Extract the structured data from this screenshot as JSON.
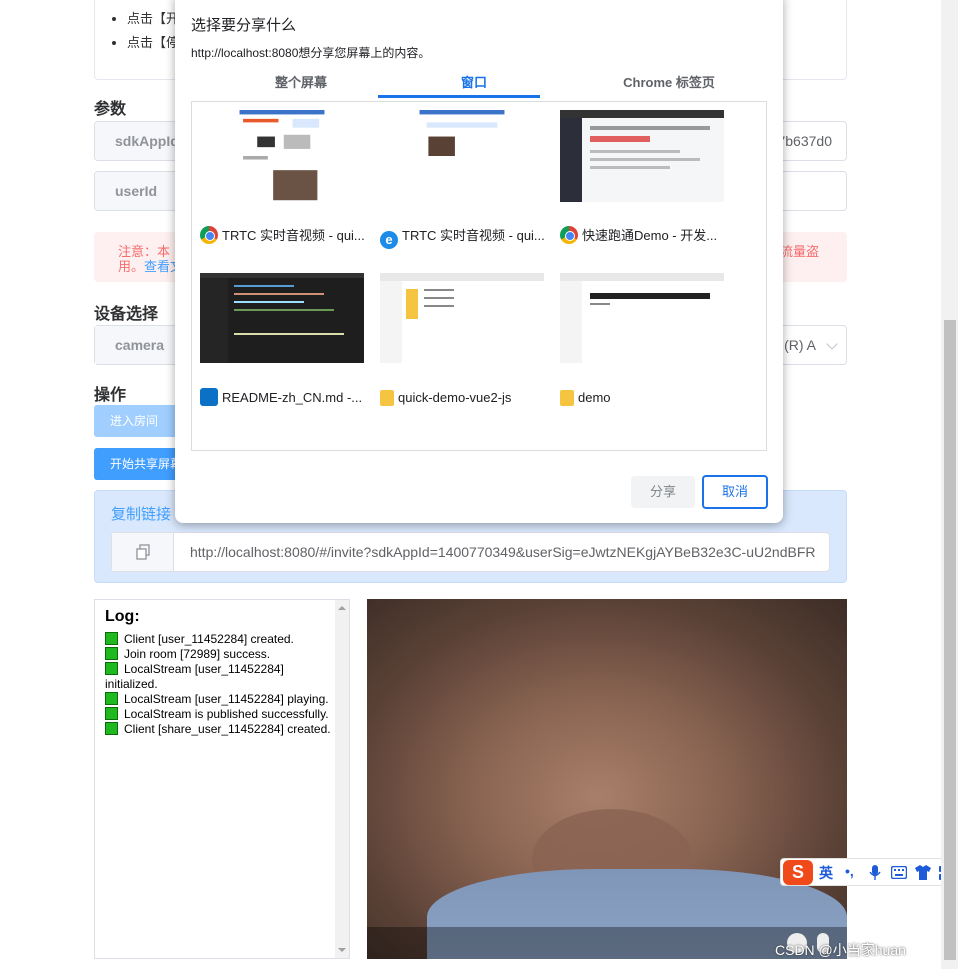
{
  "tips": {
    "items": [
      "点击【开",
      "点击【停"
    ]
  },
  "params": {
    "title": "参数",
    "sdkappid_label": "sdkAppId",
    "sdkappid_value": "7b637d0",
    "userid_label": "userId"
  },
  "alert": {
    "left_text": "注意：本 ",
    "left_text2": "用。",
    "link_text": "查看文",
    "right_text": "流量盗"
  },
  "device": {
    "title": "设备选择",
    "camera_label": "camera",
    "camera_value": "(R) A"
  },
  "actions": {
    "title": "操作",
    "enter_room": "进入房间",
    "start_share": "开始共享屏幕"
  },
  "copy_link": {
    "title": "复制链接",
    "url": "http://localhost:8080/#/invite?sdkAppId=1400770349&userSig=eJwtzNEKgjAYBeB32e3C-uU2ndBFR"
  },
  "log": {
    "title": "Log:",
    "entries": [
      "Client [user_11452284] created.",
      "Join room [72989] success.",
      "LocalStream [user_11452284] initialized.",
      "LocalStream [user_11452284] playing.",
      "LocalStream is published successfully.",
      "Client [share_user_11452284] created."
    ]
  },
  "dialog": {
    "title": "选择要分享什么",
    "subtitle": "http://localhost:8080想分享您屏幕上的内容。",
    "tabs": [
      "整个屏幕",
      "窗口",
      "Chrome 标签页"
    ],
    "active_tab": 1,
    "windows": [
      {
        "label": "TRTC 实时音视频 - qui...",
        "icon": "chrome-icon"
      },
      {
        "label": "TRTC 实时音视频 - qui...",
        "icon": "edge-icon"
      },
      {
        "label": "快速跑通Demo - 开发...",
        "icon": "chrome-icon"
      },
      {
        "label": "README-zh_CN.md -...",
        "icon": "vscode-icon"
      },
      {
        "label": "quick-demo-vue2-js",
        "icon": "folder-icon"
      },
      {
        "label": "demo",
        "icon": "folder-icon"
      }
    ],
    "share_button": "分享",
    "cancel_button": "取消"
  },
  "ime": {
    "logo": "S",
    "lang": "英"
  },
  "watermark": "CSDN @小当家huan",
  "colors": {
    "primary": "#409eff",
    "chrome_blue": "#1a73e8",
    "log_green": "#1fb81f"
  }
}
